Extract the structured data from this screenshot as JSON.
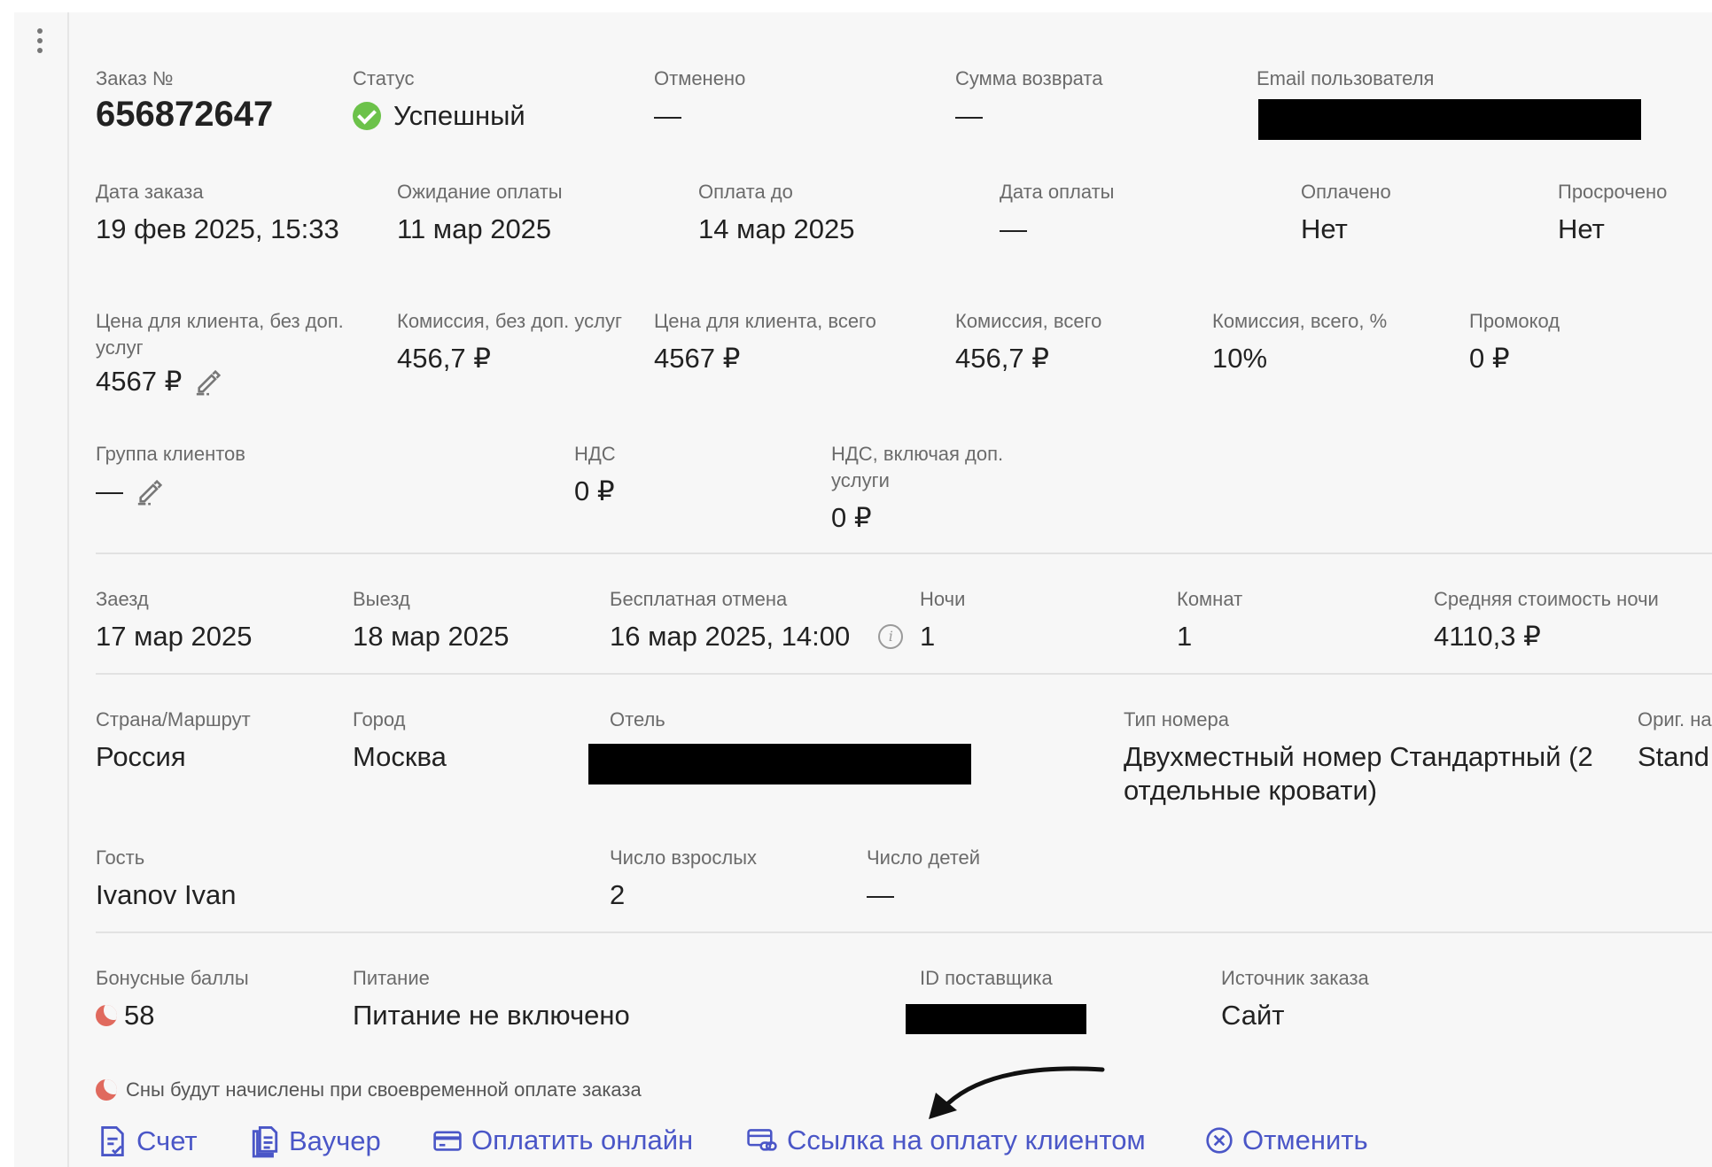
{
  "order": {
    "label": "Заказ №",
    "value": "656872647"
  },
  "status": {
    "label": "Статус",
    "value": "Успешный"
  },
  "cancelled": {
    "label": "Отменено",
    "value": "—"
  },
  "refund": {
    "label": "Сумма возврата",
    "value": "—"
  },
  "email": {
    "label": "Email пользователя"
  },
  "order_date": {
    "label": "Дата заказа",
    "value": "19 фев 2025, 15:33"
  },
  "awaiting": {
    "label": "Ожидание оплаты",
    "value": "11 мар 2025"
  },
  "pay_until": {
    "label": "Оплата до",
    "value": "14 мар 2025"
  },
  "pay_date": {
    "label": "Дата оплаты",
    "value": "—"
  },
  "paid": {
    "label": "Оплачено",
    "value": "Нет"
  },
  "overdue": {
    "label": "Просрочено",
    "value": "Нет"
  },
  "price_client": {
    "label": "Цена для клиента, без доп. услуг",
    "value": "4567 ₽"
  },
  "commission": {
    "label": "Комиссия, без доп. услуг",
    "value": "456,7 ₽"
  },
  "price_total": {
    "label": "Цена для клиента, всего",
    "value": "4567 ₽"
  },
  "commission_total": {
    "label": "Комиссия, всего",
    "value": "456,7 ₽"
  },
  "commission_pct": {
    "label": "Комиссия, всего, %",
    "value": "10%"
  },
  "promo": {
    "label": "Промокод",
    "value": "0 ₽"
  },
  "client_group": {
    "label": "Группа клиентов",
    "value": "—"
  },
  "vat": {
    "label": "НДС",
    "value": "0 ₽"
  },
  "vat_total": {
    "label": "НДС, включая доп. услуги",
    "value": "0 ₽"
  },
  "checkin": {
    "label": "Заезд",
    "value": "17 мар 2025"
  },
  "checkout": {
    "label": "Выезд",
    "value": "18 мар 2025"
  },
  "free_cancel": {
    "label": "Бесплатная отмена",
    "value": "16 мар 2025, 14:00",
    "info": "i"
  },
  "nights": {
    "label": "Ночи",
    "value": "1"
  },
  "rooms": {
    "label": "Комнат",
    "value": "1"
  },
  "avg_night": {
    "label": "Средняя стоимость ночи",
    "value": "4110,3 ₽"
  },
  "country": {
    "label": "Страна/Маршрут",
    "value": "Россия"
  },
  "city": {
    "label": "Город",
    "value": "Москва"
  },
  "hotel": {
    "label": "Отель"
  },
  "room_type": {
    "label": "Тип номера",
    "value": "Двухместный номер Стандартный (2 отдельные кровати)"
  },
  "orig_name": {
    "label": "Ориг. на",
    "value": "Stand"
  },
  "guest": {
    "label": "Гость",
    "value": "Ivanov Ivan"
  },
  "adults": {
    "label": "Число взрослых",
    "value": "2"
  },
  "children": {
    "label": "Число детей",
    "value": "—"
  },
  "bonus": {
    "label": "Бонусные баллы",
    "value": "58"
  },
  "meals": {
    "label": "Питание",
    "value": "Питание не включено"
  },
  "supplier_id": {
    "label": "ID поставщика"
  },
  "source": {
    "label": "Источник заказа",
    "value": "Сайт"
  },
  "note": "Сны будут начислены при своевременной оплате заказа",
  "actions": {
    "invoice": "Счет",
    "voucher": "Ваучер",
    "pay_online": "Оплатить онлайн",
    "pay_link": "Ссылка на оплату клиентом",
    "cancel": "Отменить"
  },
  "colors": {
    "accent": "#4a56c7",
    "success": "#6cc24a",
    "bonus": "#e06a5e"
  },
  "icons": [
    "kebab-menu-icon",
    "check-circle-icon",
    "pencil-icon",
    "info-icon",
    "moon-icon",
    "document-icon",
    "copy-document-icon",
    "credit-card-icon",
    "card-link-icon",
    "cancel-circle-icon",
    "arrow-annotation"
  ]
}
